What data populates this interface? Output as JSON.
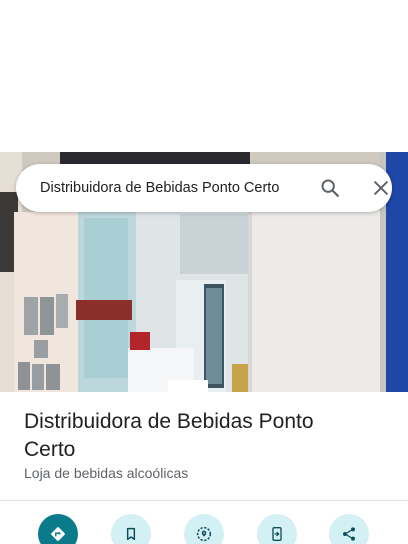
{
  "search": {
    "query": "Distribuidora de Bebidas Ponto Certo",
    "search_icon": "search-icon",
    "close_icon": "close-icon"
  },
  "place": {
    "name": "Distribuidora de Bebidas Ponto Certo",
    "category": "Loja de bebidas alcoólicas",
    "photo": "storefront-photo"
  },
  "actions": [
    {
      "icon": "directions-icon"
    },
    {
      "icon": "bookmark-icon"
    },
    {
      "icon": "nearby-icon"
    },
    {
      "icon": "send-to-phone-icon"
    },
    {
      "icon": "share-icon"
    }
  ],
  "colors": {
    "primary_action": "#0b7a8a",
    "action_background": "#d3f0f5",
    "title_text": "#202124",
    "secondary_text": "#5f6368"
  }
}
